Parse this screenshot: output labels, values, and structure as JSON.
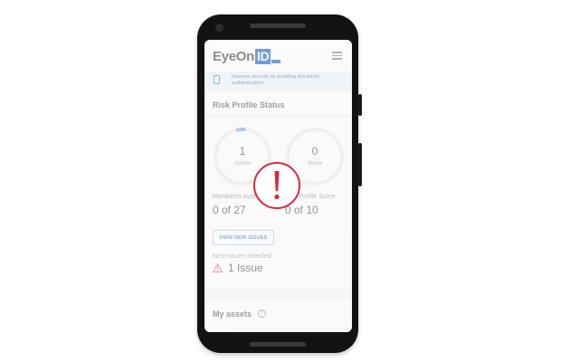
{
  "app": {
    "logo_text": "EyeOn",
    "logo_badge": "ID"
  },
  "notice": {
    "text": "Improve security by enabling two-factor authentication."
  },
  "risk_profile": {
    "title": "Risk Profile Status",
    "assets_ring": {
      "value": "1",
      "label": "Assets",
      "fill_fraction": 0.037
    },
    "score_ring": {
      "value": "0",
      "label": "Score",
      "fill_fraction": 0.0
    },
    "monitored_assets_label": "Monitored assets",
    "monitored_assets_value": "0 of 27",
    "risk_profile_score_label": "Risk Profile Score",
    "risk_profile_score_value": "0 of 10",
    "view_button_label": "VIEW NEW ISSUES",
    "new_issues_label": "New issues detected",
    "new_issues_value": "1 Issue"
  },
  "my_assets": {
    "title": "My assets",
    "help_glyph": "?"
  },
  "icons": {
    "menu": "hamburger-menu-icon",
    "notice": "phone-lock-icon",
    "warning": "warning-triangle-icon",
    "alert": "exclamation-circle-icon",
    "help": "question-circle-icon"
  },
  "colors": {
    "brand_blue": "#0a57c2",
    "accent_blue": "#7aa6e0",
    "alert_red": "#e0263c",
    "warning_red": "#e05a6a"
  }
}
